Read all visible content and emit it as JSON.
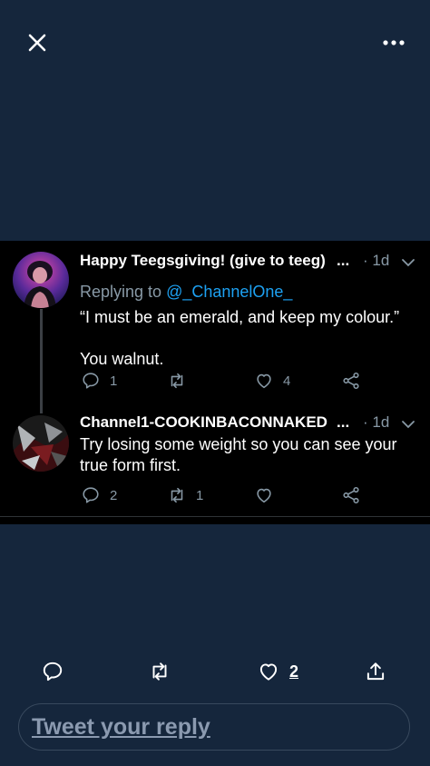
{
  "tweets": [
    {
      "name": "Happy Teegsgiving! (give to teeg)",
      "ellipsis": "...",
      "time": "· 1d",
      "replying_prefix": "Replying to ",
      "replying_handle": "@_ChannelOne_",
      "text_line1": "“I must be an emerald, and keep my colour.”",
      "text_line2": "You walnut.",
      "reply_count": "1",
      "retweet_count": "",
      "like_count": "4"
    },
    {
      "name": "Channel1-COOKINBACONNAKED",
      "ellipsis": "...",
      "time": "· 1d",
      "text_line1": "Try losing some weight so you can see your",
      "text_line2": "true form first.",
      "reply_count": "2",
      "retweet_count": "1",
      "like_count": ""
    }
  ],
  "bottom_bar": {
    "like_count": "2"
  },
  "reply_box": {
    "placeholder": "Tweet your reply"
  },
  "icons": {
    "close": "close-icon",
    "more": "more-dots-icon",
    "reply": "reply-bubble-icon",
    "retweet": "retweet-icon",
    "like": "heart-icon",
    "share": "share-icon"
  },
  "colors": {
    "background": "#15263c",
    "thread_background": "#000000",
    "link": "#1da1f2",
    "muted": "#8899a6"
  }
}
